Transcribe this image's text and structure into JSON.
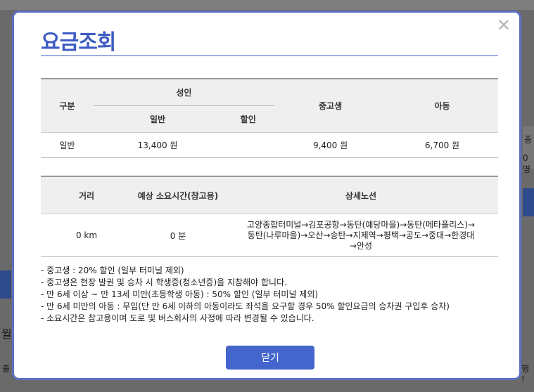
{
  "background": {
    "right_glyph_1": "중",
    "right_glyph_2": "0명",
    "left_glyph": "월",
    "bottom_left": "출",
    "bottom_right": "행 !"
  },
  "modal": {
    "title": "요금조회",
    "close_label": "✕",
    "fare_table": {
      "col_category": "구분",
      "col_adult": "성인",
      "col_adult_general": "일반",
      "col_adult_discount": "할인",
      "col_student": "중고생",
      "col_child": "아동",
      "rows": [
        {
          "category": "일반",
          "adult_general": "13,400 원",
          "adult_discount": "",
          "student": "9,400 원",
          "child": "6,700 원"
        }
      ]
    },
    "route_table": {
      "col_distance": "거리",
      "col_duration": "예상 소요시간(참고용)",
      "col_route": "상세노선",
      "rows": [
        {
          "distance": "0 km",
          "duration": "0 분",
          "route_line1": "고양종합터미널→김포공항→동탄(예당마을)→동탄(메타폴리스)→",
          "route_line2": "동탄(나루마을)→오산→송탄→지제역→평택→공도→중대→한경대",
          "route_line3": "→안성"
        }
      ]
    },
    "notes": [
      "- 중고생 : 20% 할인 (일부 터미널 제외)",
      "- 중고생은 현장 발권 및 승차 시 학생증(청소년증)을 지참해야 합니다.",
      "- 만 6세 이상 ~ 만 13세 미만(초등학생 아동) : 50% 할인 (일부 터미널 제외)",
      "- 만 6세 미만의 아동 : 무임(단 만 6세 이하의 아동이라도 좌석을 요구할 경우 50% 할인요금의 승차권 구입후 승차)",
      "- 소요시간은 참고용이며 도로 및 버스회사의 사정에 따라 변경될 수 있습니다."
    ],
    "confirm_label": "닫기"
  }
}
